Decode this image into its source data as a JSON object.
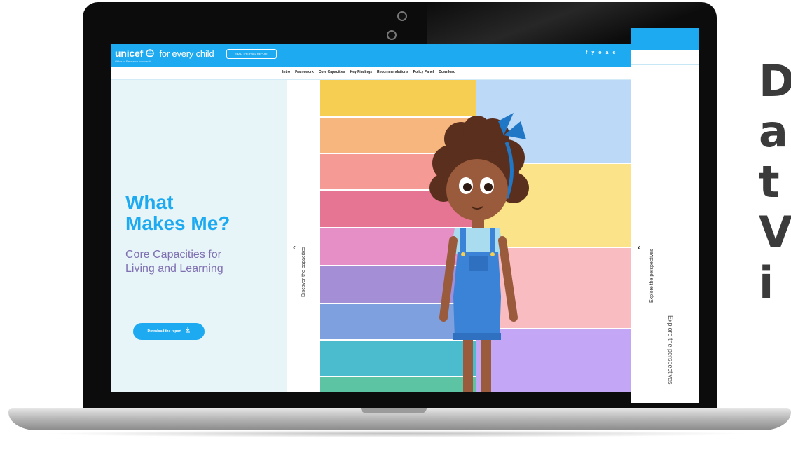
{
  "side_text": {
    "lines": [
      "D",
      "a",
      "t",
      "V",
      "i"
    ]
  },
  "screen": {
    "logo_text": "unicef",
    "logo_tagline": "for every child",
    "logo_subtitle": "Office of Research-Innocenti",
    "report_button": "READ THE FULL REPORT",
    "social_icons": [
      "f",
      "y",
      "o",
      "a",
      "c"
    ],
    "nav": {
      "items": [
        "Intro",
        "Framework",
        "Core Capacities",
        "Key Findings",
        "Recommendations",
        "Policy Panel",
        "Download"
      ]
    },
    "hero": {
      "title_line1": "What",
      "title_line2": "Makes Me?",
      "subtitle_line1": "Core Capacities for",
      "subtitle_line2": "Living and Learning",
      "download_button": "Download the report"
    },
    "panels": {
      "left_label": "Discover the capacities",
      "right_label": "Explore the perspectives"
    },
    "back_window_label": "Explore the perspectives",
    "colors": {
      "brand_blue": "#1eaaf1",
      "hero_bg": "#e7f5f8",
      "purple_text": "#7f6fb1"
    }
  }
}
